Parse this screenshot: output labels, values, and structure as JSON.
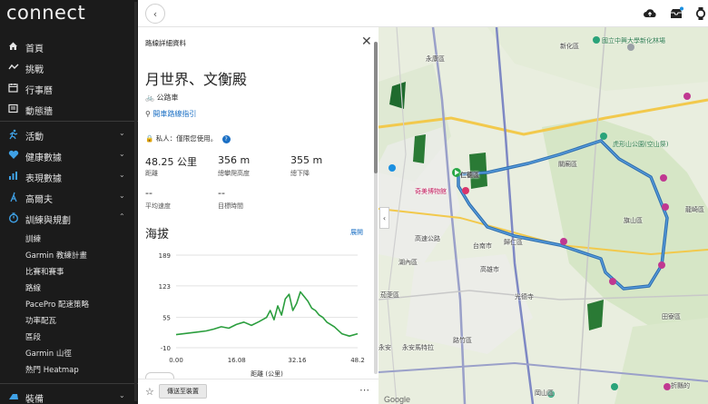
{
  "app": {
    "logo": "connect"
  },
  "sidebar": {
    "items": [
      {
        "label": "首頁",
        "icon": "home-icon"
      },
      {
        "label": "挑戰",
        "icon": "challenge-icon"
      },
      {
        "label": "行事曆",
        "icon": "calendar-icon"
      },
      {
        "label": "動態牆",
        "icon": "newsfeed-icon"
      },
      {
        "label": "活動",
        "icon": "activities-icon"
      },
      {
        "label": "健康數據",
        "icon": "heart-icon"
      },
      {
        "label": "表現數據",
        "icon": "performance-icon"
      },
      {
        "label": "高爾夫",
        "icon": "golf-icon"
      },
      {
        "label": "訓練與規劃",
        "icon": "training-icon"
      },
      {
        "label": "裝備",
        "icon": "gear-icon"
      }
    ],
    "sub_items": [
      "訓練",
      "Garmin 教練計畫",
      "比賽和賽事",
      "路線",
      "PacePro 配速策略",
      "功率配瓦",
      "區段",
      "Garmin 山徑",
      "熱門 Heatmap"
    ]
  },
  "panel": {
    "header": "路線詳細資料",
    "title": "月世界、文衡殿",
    "activity_type": "公路車",
    "directions_link": "開車路線指引",
    "privacy": "私人：僅限您使用。",
    "stats": [
      {
        "value": "48.25 公里",
        "label": "距離"
      },
      {
        "value": "356 m",
        "label": "總攀爬高度"
      },
      {
        "value": "355 m",
        "label": "總下降"
      },
      {
        "value": "--",
        "label": "平均速度"
      },
      {
        "value": "--",
        "label": "目標時間"
      }
    ],
    "elevation_title": "海拔",
    "expand_label": "展開",
    "send_button": "傳送至裝置"
  },
  "map_labels": [
    "永康區",
    "仁德區",
    "奇美博物館",
    "新化區",
    "虎形山公園(空山祭)",
    "關廟區",
    "龍崎區",
    "歸仁區",
    "湖內區",
    "高雄市",
    "光德寺",
    "茄萣區",
    "路竹區",
    "田寮區",
    "永安",
    "岡山區",
    "旗山區",
    "國立中興大學新化林場",
    "台南市",
    "高速公路",
    "永安馬特拉",
    "折縣的",
    "Google"
  ],
  "chart_data": {
    "type": "area",
    "title": "海拔",
    "xlabel": "距離 (公里)",
    "ylabel": "",
    "xlim": [
      0,
      48.2
    ],
    "ylim": [
      -10,
      189
    ],
    "x_ticks": [
      "0.00",
      "16.08",
      "32.16",
      "48.2"
    ],
    "y_ticks": [
      "189",
      "123",
      "55",
      "-10"
    ],
    "grid": true,
    "series": [
      {
        "color": "#2b9e3e",
        "x": [
          0,
          2,
          4,
          6,
          8,
          10,
          12,
          14,
          16,
          18,
          20,
          22,
          24,
          25,
          26,
          27,
          28,
          29,
          30,
          31,
          32,
          33,
          34,
          35,
          36,
          37,
          38,
          39,
          40,
          42,
          44,
          46,
          48.2
        ],
        "y": [
          18,
          20,
          22,
          24,
          26,
          30,
          35,
          32,
          40,
          45,
          38,
          46,
          55,
          70,
          50,
          80,
          60,
          95,
          105,
          70,
          85,
          110,
          100,
          90,
          75,
          70,
          60,
          55,
          45,
          35,
          20,
          15,
          20
        ]
      }
    ]
  }
}
